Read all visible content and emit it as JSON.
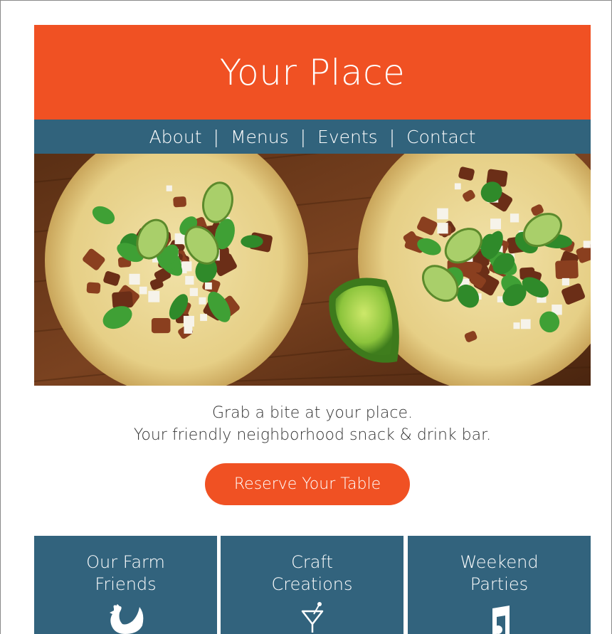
{
  "colors": {
    "brand_orange": "#F05123",
    "nav_blue": "#31637C",
    "tile_blue": "#32637D",
    "text_dark": "#333333"
  },
  "header": {
    "title": "Your Place"
  },
  "nav": {
    "items": [
      {
        "label": "About"
      },
      {
        "label": "Menus"
      },
      {
        "label": "Events"
      },
      {
        "label": "Contact"
      }
    ],
    "separator": "|"
  },
  "hero": {
    "image_subject": "tacos-photo"
  },
  "tagline": {
    "line1": "Grab a bite at your place.",
    "line2": "Your friendly neighborhood snack & drink bar."
  },
  "cta": {
    "label": "Reserve Your Table"
  },
  "tiles": [
    {
      "title": "Our Farm\nFriends",
      "icon": "chicken-icon"
    },
    {
      "title": "Craft\nCreations",
      "icon": "cocktail-icon"
    },
    {
      "title": "Weekend\nParties",
      "icon": "music-note-icon"
    }
  ]
}
